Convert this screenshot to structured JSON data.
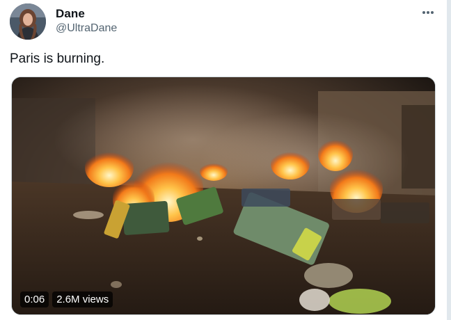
{
  "author": {
    "display_name": "Dane",
    "handle": "@UltraDane"
  },
  "tweet": {
    "text": "Paris is burning."
  },
  "media": {
    "type": "video",
    "duration": "0:06",
    "views": "2.6M views"
  },
  "icons": {
    "more": "more-horizontal-icon",
    "avatar": "profile-avatar"
  }
}
